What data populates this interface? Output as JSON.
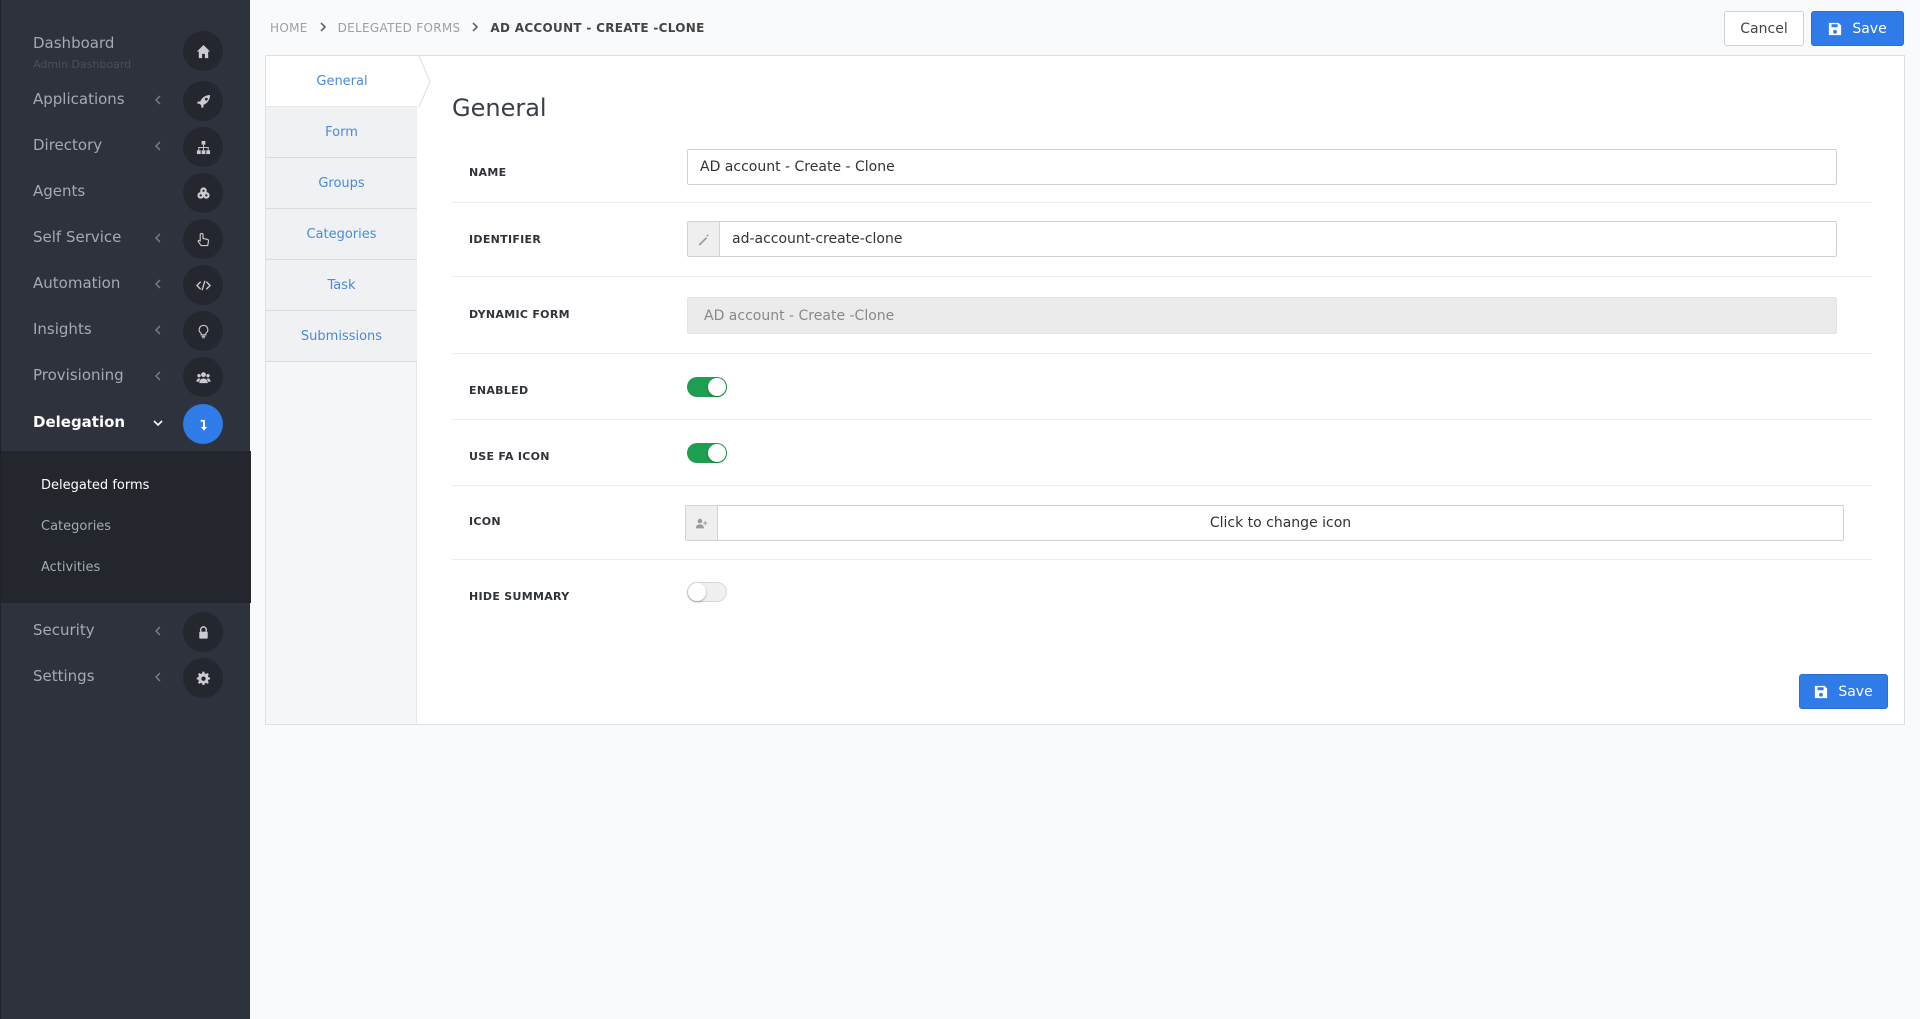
{
  "sidebar": {
    "items": [
      {
        "label": "Dashboard",
        "sub": "Admin Dashboard",
        "icon": "home-icon"
      },
      {
        "label": "Applications",
        "icon": "rocket-icon"
      },
      {
        "label": "Directory",
        "icon": "sitemap-icon"
      },
      {
        "label": "Agents",
        "icon": "cogs-icon"
      },
      {
        "label": "Self Service",
        "icon": "hand-pointer-icon"
      },
      {
        "label": "Automation",
        "icon": "code-icon"
      },
      {
        "label": "Insights",
        "icon": "lightbulb-icon"
      },
      {
        "label": "Provisioning",
        "icon": "users-icon"
      },
      {
        "label": "Delegation",
        "icon": "level-down-icon"
      },
      {
        "label": "Security",
        "icon": "lock-icon"
      },
      {
        "label": "Settings",
        "icon": "gear-icon"
      }
    ],
    "subitems": [
      "Delegated forms",
      "Categories",
      "Activities"
    ]
  },
  "breadcrumb": {
    "home": "HOME",
    "parent": "DELEGATED FORMS",
    "current": "AD ACCOUNT - CREATE -CLONE"
  },
  "toolbar": {
    "cancel_label": "Cancel",
    "save_label": "Save"
  },
  "tabs": [
    "General",
    "Form",
    "Groups",
    "Categories",
    "Task",
    "Submissions"
  ],
  "form": {
    "title": "General",
    "name_label": "NAME",
    "name_value": "AD account - Create - Clone",
    "identifier_label": "IDENTIFIER",
    "identifier_value": "ad-account-create-clone",
    "dynamic_form_label": "DYNAMIC FORM",
    "dynamic_form_value": "AD account - Create -Clone",
    "enabled_label": "ENABLED",
    "enabled": true,
    "use_fa_icon_label": "USE FA ICON",
    "use_fa_icon": true,
    "icon_label": "ICON",
    "icon_button_label": "Click to change icon",
    "icon_name": "user-plus-icon",
    "hide_summary_label": "HIDE SUMMARY",
    "hide_summary": false,
    "save_label": "Save"
  },
  "colors": {
    "sidebar_bg": "#2e323c",
    "accent": "#2f7be8",
    "toggle_on": "#1e9e4f",
    "tab_text": "#4a8ad8"
  }
}
